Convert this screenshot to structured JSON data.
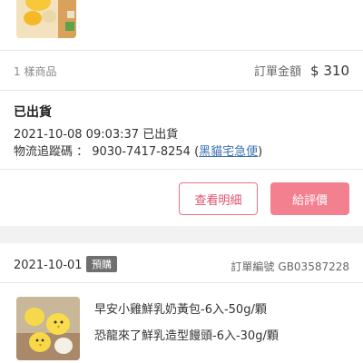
{
  "order_top": {
    "item_count": "1 樣商品",
    "total_label": "訂單金額",
    "total_value": "$ 310",
    "status": "已出貨",
    "ship_datetime": "2021-10-08 09:03:37 已出貨",
    "tracking_label": "物流追蹤碼 ：",
    "tracking_number": "9030-7417-8254",
    "carrier_open": "(",
    "carrier": "黑貓宅急便",
    "carrier_close": ")",
    "detail_button": "查看明細",
    "review_button": "給評價"
  },
  "order_bottom": {
    "date": "2021-10-01",
    "badge": "預購",
    "order_no_label": "訂單編號",
    "order_no": "GB03587228",
    "products": [
      "早安小雞鮮乳奶黃包-6入-50g/顆",
      "恐龍來了鮮乳造型饅頭-6入-30g/顆"
    ]
  },
  "colors": {
    "accent": "#f3808f",
    "accent_border": "#ef6f85",
    "link": "#3a72b0",
    "badge": "#6f6f6f"
  }
}
